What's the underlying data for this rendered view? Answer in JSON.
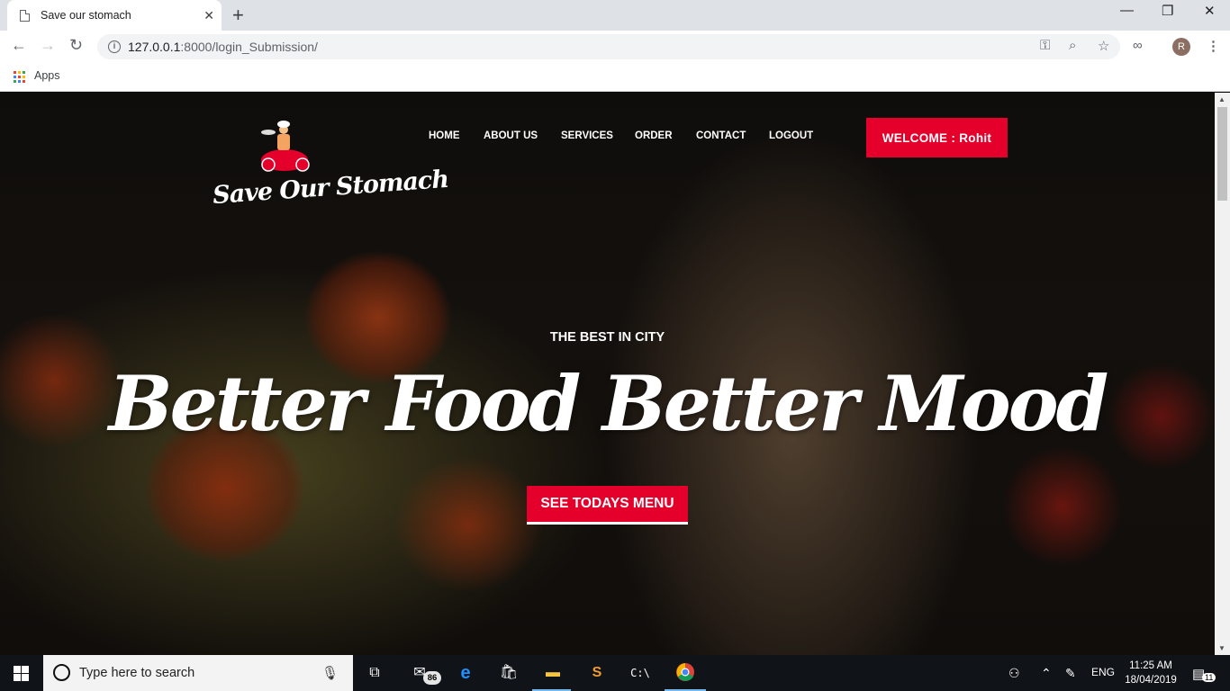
{
  "browser": {
    "tab_title": "Save our stomach",
    "tab_close": "✕",
    "new_tab": "+",
    "window_controls": {
      "minimize": "—",
      "maximize": "❐",
      "close": "✕"
    },
    "url_host": "127.0.0.1",
    "url_rest": ":8000/login_Submission/",
    "bookmarks": {
      "apps_label": "Apps"
    },
    "avatar_letter": "R"
  },
  "site": {
    "logo_text": "Save Our Stomach",
    "nav": [
      "HOME",
      "ABOUT US",
      "SERVICES",
      "ORDER",
      "CONTACT",
      "LOGOUT"
    ],
    "welcome_button": "WELCOME : Rohit",
    "hero": {
      "kicker": "THE BEST IN CITY",
      "headline": "Better Food Better Mood",
      "cta": "SEE TODAYS MENU"
    },
    "accent_color": "#e4002b"
  },
  "taskbar": {
    "search_placeholder": "Type here to search",
    "mail_badge": "86",
    "language": "ENG",
    "time": "11:25 AM",
    "date": "18/04/2019",
    "notification_count": "11",
    "icons": [
      "windows-start-icon",
      "cortana-icon",
      "microphone-icon",
      "task-view-icon",
      "mail-icon",
      "edge-icon",
      "store-icon",
      "file-explorer-icon",
      "sublime-text-icon",
      "command-prompt-icon",
      "chrome-icon",
      "people-icon",
      "chevron-up-icon",
      "pen-icon",
      "notification-icon"
    ]
  }
}
